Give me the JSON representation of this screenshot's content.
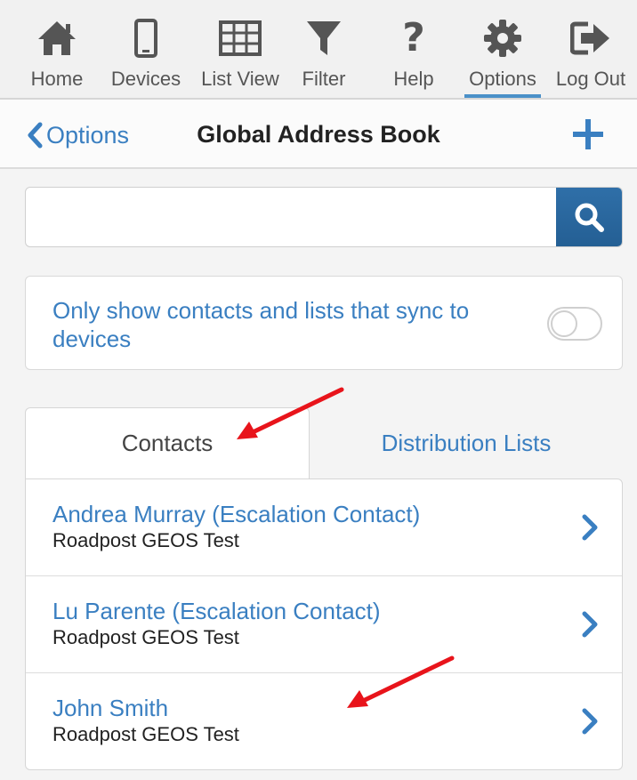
{
  "nav": {
    "items": [
      {
        "label": "Home",
        "icon": "home-icon"
      },
      {
        "label": "Devices",
        "icon": "phone-icon"
      },
      {
        "label": "List View",
        "icon": "grid-icon"
      },
      {
        "label": "Filter",
        "icon": "filter-icon"
      },
      {
        "label": "Help",
        "icon": "question-icon"
      },
      {
        "label": "Options",
        "icon": "gear-icon",
        "active": true
      },
      {
        "label": "Log Out",
        "icon": "logout-icon"
      }
    ]
  },
  "header": {
    "back_label": "Options",
    "title": "Global Address Book",
    "add_icon": "plus-icon"
  },
  "search": {
    "value": "",
    "placeholder": "",
    "button_icon": "search-icon"
  },
  "sync_toggle": {
    "label": "Only show contacts and lists that sync to devices",
    "on": false
  },
  "tabs": [
    {
      "label": "Contacts",
      "active": true
    },
    {
      "label": "Distribution Lists",
      "active": false
    }
  ],
  "contacts": [
    {
      "name": "Andrea Murray (Escalation Contact)",
      "org": "Roadpost GEOS Test"
    },
    {
      "name": "Lu Parente (Escalation Contact)",
      "org": "Roadpost GEOS Test"
    },
    {
      "name": "John Smith",
      "org": "Roadpost GEOS Test"
    }
  ],
  "colors": {
    "accent": "#3a7fc1",
    "search_button": "#2a679d",
    "annotation_arrow": "#e8141b"
  }
}
